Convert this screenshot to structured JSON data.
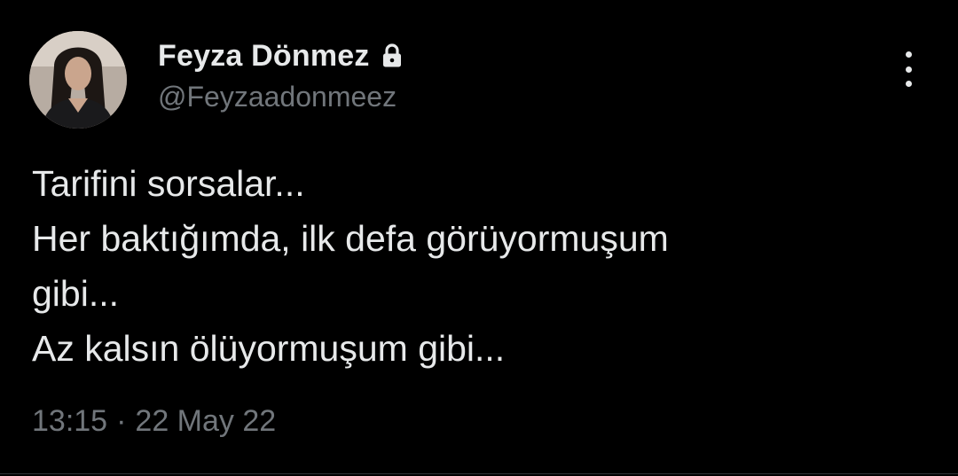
{
  "author": {
    "display_name": "Feyza Dönmez",
    "handle": "@Feyzaadonmeez",
    "protected_icon": "lock-icon",
    "avatar_icon": "profile-photo"
  },
  "menu": {
    "icon": "more-vertical-icon"
  },
  "tweet": {
    "lines": [
      "Tarifini sorsalar...",
      "Her baktığımda, ilk defa görüyormuşum",
      "gibi...",
      "Az kalsın ölüyormuşum gibi..."
    ],
    "time": "13:15",
    "separator": "·",
    "date": "22 May 22"
  },
  "colors": {
    "background": "#000000",
    "primary_text": "#e7e9ea",
    "secondary_text": "#71767b",
    "divider": "#2f3336"
  }
}
